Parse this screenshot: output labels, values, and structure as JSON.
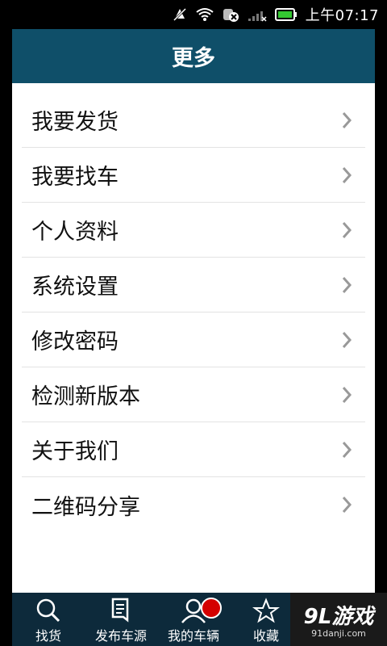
{
  "status_bar": {
    "time": "上午07:17",
    "icons": [
      "mute-icon",
      "wifi-icon",
      "sync-off-icon",
      "signal-icon",
      "battery-icon"
    ],
    "battery_color": "#34c832"
  },
  "header": {
    "title": "更多",
    "color": "#0f4f69"
  },
  "menu": {
    "items": [
      {
        "label": "我要发货"
      },
      {
        "label": "我要找车"
      },
      {
        "label": "个人资料"
      },
      {
        "label": "系统设置"
      },
      {
        "label": "修改密码"
      },
      {
        "label": "检测新版本"
      },
      {
        "label": "关于我们"
      },
      {
        "label": "二维码分享"
      }
    ]
  },
  "bottom_nav": {
    "tabs": [
      {
        "label": "找货",
        "icon": "search-icon"
      },
      {
        "label": "发布车源",
        "icon": "document-icon"
      },
      {
        "label": "我的车辆",
        "icon": "person-icon"
      },
      {
        "label": "收藏",
        "icon": "star-icon"
      }
    ],
    "badge_color": "#d40000"
  },
  "watermark": {
    "title": "9L游戏",
    "subtitle": "91danji.com"
  }
}
